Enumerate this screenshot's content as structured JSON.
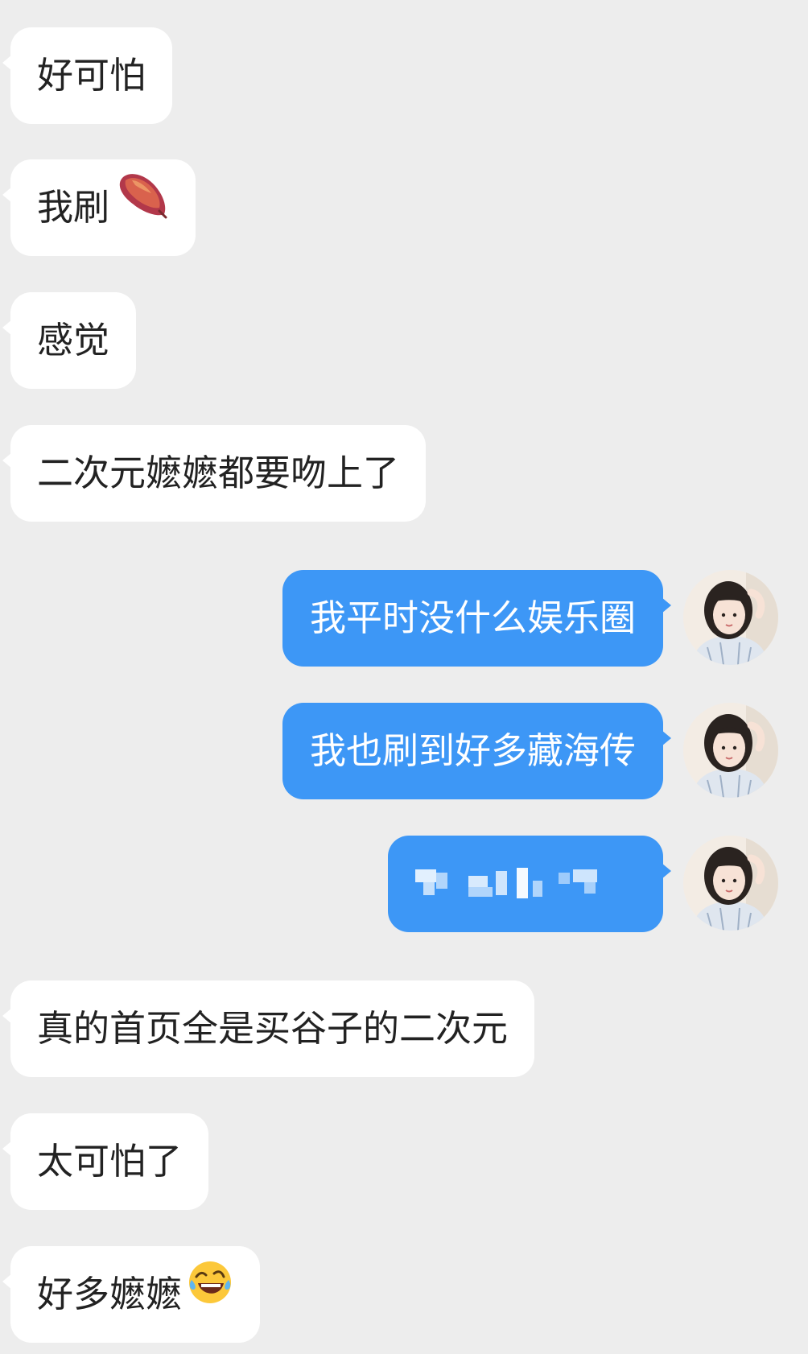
{
  "messages": [
    {
      "side": "in",
      "text": "好可怕"
    },
    {
      "side": "in",
      "text": "我刷",
      "emoji": "sweet-potato-emoji"
    },
    {
      "side": "in",
      "text": "感觉"
    },
    {
      "side": "in",
      "text": "二次元嬷嬷都要吻上了"
    },
    {
      "side": "out",
      "text": "我平时没什么娱乐圈",
      "avatar": "user-avatar"
    },
    {
      "side": "out",
      "text": "我也刷到好多藏海传",
      "avatar": "user-avatar"
    },
    {
      "side": "out",
      "text": "",
      "content": "blurred-pixelated-text",
      "avatar": "user-avatar"
    },
    {
      "side": "in",
      "text": "真的首页全是买谷子的二次元"
    },
    {
      "side": "in",
      "text": "太可怕了"
    },
    {
      "side": "in",
      "text": "好多嬷嬷",
      "emoji": "rolling-on-floor-laughing-emoji"
    }
  ],
  "colors": {
    "background": "#ededed",
    "incoming_bubble": "#ffffff",
    "outgoing_bubble": "#3d97f6",
    "incoming_text": "#222222",
    "outgoing_text": "#ffffff"
  }
}
